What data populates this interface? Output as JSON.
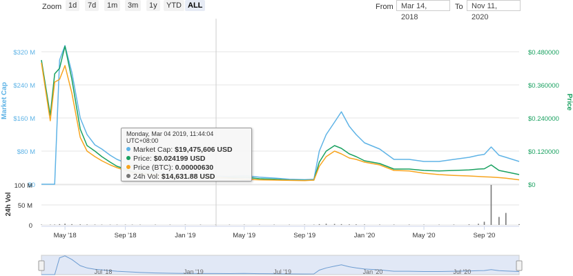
{
  "toolbar": {
    "zoom_label": "Zoom",
    "zoom_buttons": [
      "1d",
      "7d",
      "1m",
      "3m",
      "1y",
      "YTD",
      "ALL"
    ],
    "active_zoom": "ALL",
    "from_label": "From",
    "from_value": "Mar 14, 2018",
    "to_label": "To",
    "to_value": "Nov 11, 2020"
  },
  "tooltip": {
    "date": "Monday, Mar 04 2019, 11:44:04 UTC+08:00",
    "rows": [
      {
        "label": "Market Cap:",
        "value": "$19,475,606 USD",
        "color": "#5eb3e6"
      },
      {
        "label": "Price:",
        "value": "$0.024199 USD",
        "color": "#18a05f"
      },
      {
        "label": "Price (BTC):",
        "value": "0.00000630",
        "color": "#f7a41d"
      },
      {
        "label": "24h Vol:",
        "value": "$14,631.88 USD",
        "color": "#777777"
      }
    ]
  },
  "colors": {
    "market_cap": "#5eb3e6",
    "price": "#18a05f",
    "price_btc": "#f7a41d",
    "volume": "#777777",
    "navigator_fill": "#c9d6ef"
  },
  "chart_data": {
    "type": "line",
    "x_tick_labels": [
      "May '18",
      "Sep '18",
      "Jan '19",
      "May '19",
      "Sep '19",
      "Jan '20",
      "May '20",
      "Sep '20"
    ],
    "navigator_tick_labels": [
      "Jul '18",
      "Jan '19",
      "Jul '19",
      "Jan '20",
      "Jul '20"
    ],
    "left_axis": {
      "label": "Market Cap",
      "tick_labels": [
        "$0",
        "$80 M",
        "$160 M",
        "$240 M",
        "$320 M"
      ],
      "range": [
        0,
        320000000
      ]
    },
    "right_axis": {
      "label": "Price",
      "tick_labels": [
        "$0",
        "$0.120000",
        "$0.240000",
        "$0.360000",
        "$0.480000"
      ],
      "range": [
        0,
        0.48
      ]
    },
    "volume_axis": {
      "label": "24h Vol",
      "tick_labels": [
        "0",
        "50 M",
        "100 M"
      ],
      "range": [
        0,
        100000000
      ]
    },
    "x": [
      "2018-03-14",
      "2018-04-01",
      "2018-04-10",
      "2018-04-20",
      "2018-05-01",
      "2018-05-15",
      "2018-06-01",
      "2018-06-15",
      "2018-07-01",
      "2018-07-15",
      "2018-08-01",
      "2018-08-15",
      "2018-09-01",
      "2018-09-15",
      "2018-10-01",
      "2018-11-01",
      "2018-12-01",
      "2019-01-01",
      "2019-02-01",
      "2019-03-04",
      "2019-04-01",
      "2019-05-01",
      "2019-06-01",
      "2019-07-01",
      "2019-08-01",
      "2019-09-01",
      "2019-09-20",
      "2019-10-01",
      "2019-10-15",
      "2019-11-01",
      "2019-11-15",
      "2019-12-01",
      "2019-12-15",
      "2020-01-01",
      "2020-02-01",
      "2020-03-01",
      "2020-04-01",
      "2020-05-01",
      "2020-06-01",
      "2020-07-01",
      "2020-08-01",
      "2020-08-20",
      "2020-09-01",
      "2020-09-15",
      "2020-10-01",
      "2020-10-15",
      "2020-11-11"
    ],
    "series": [
      {
        "name": "Market Cap",
        "axis": "left",
        "values": [
          0,
          0,
          0,
          300000000,
          335000000,
          270000000,
          160000000,
          120000000,
          95000000,
          85000000,
          70000000,
          60000000,
          52000000,
          45000000,
          38000000,
          30000000,
          25000000,
          22000000,
          20000000,
          19475606,
          19000000,
          21000000,
          17000000,
          15000000,
          12000000,
          11000000,
          12000000,
          80000000,
          120000000,
          150000000,
          175000000,
          140000000,
          120000000,
          100000000,
          85000000,
          60000000,
          60000000,
          55000000,
          55000000,
          60000000,
          65000000,
          70000000,
          72000000,
          90000000,
          70000000,
          65000000,
          55000000
        ]
      },
      {
        "name": "Price",
        "axis": "right",
        "values": [
          0.45,
          0.25,
          0.4,
          0.42,
          0.5,
          0.38,
          0.2,
          0.14,
          0.12,
          0.1,
          0.08,
          0.065,
          0.055,
          0.045,
          0.04,
          0.035,
          0.03,
          0.027,
          0.025,
          0.024199,
          0.024,
          0.026,
          0.02,
          0.018,
          0.015,
          0.014,
          0.015,
          0.08,
          0.12,
          0.14,
          0.13,
          0.11,
          0.1,
          0.085,
          0.075,
          0.055,
          0.055,
          0.05,
          0.048,
          0.05,
          0.052,
          0.055,
          0.056,
          0.07,
          0.05,
          0.045,
          0.035
        ]
      },
      {
        "name": "Price (BTC)",
        "axis": "right",
        "values": [
          0.44,
          0.23,
          0.37,
          0.38,
          0.43,
          0.33,
          0.17,
          0.12,
          0.1,
          0.085,
          0.07,
          0.06,
          0.05,
          0.042,
          0.038,
          0.034,
          0.031,
          0.029,
          0.027,
          0.025,
          0.022,
          0.018,
          0.016,
          0.015,
          0.014,
          0.013,
          0.015,
          0.065,
          0.1,
          0.12,
          0.11,
          0.095,
          0.09,
          0.08,
          0.07,
          0.05,
          0.048,
          0.04,
          0.035,
          0.032,
          0.03,
          0.028,
          0.027,
          0.026,
          0.024,
          0.022,
          0.016
        ]
      },
      {
        "name": "24h Vol",
        "axis": "volume",
        "values": [
          0,
          500000,
          1000000,
          2000000,
          3000000,
          2000000,
          1500000,
          1200000,
          1000000,
          800000,
          600000,
          500000,
          400000,
          300000,
          200000,
          150000,
          100000,
          50000,
          30000,
          14631.88,
          30000,
          50000,
          40000,
          30000,
          30000,
          50000,
          100000,
          2000000,
          3000000,
          2500000,
          2000000,
          1500000,
          1500000,
          1200000,
          1000000,
          1000000,
          1000000,
          800000,
          800000,
          1000000,
          1500000,
          3000000,
          8000000,
          100000000,
          20000000,
          30000000,
          2000000
        ]
      }
    ]
  }
}
